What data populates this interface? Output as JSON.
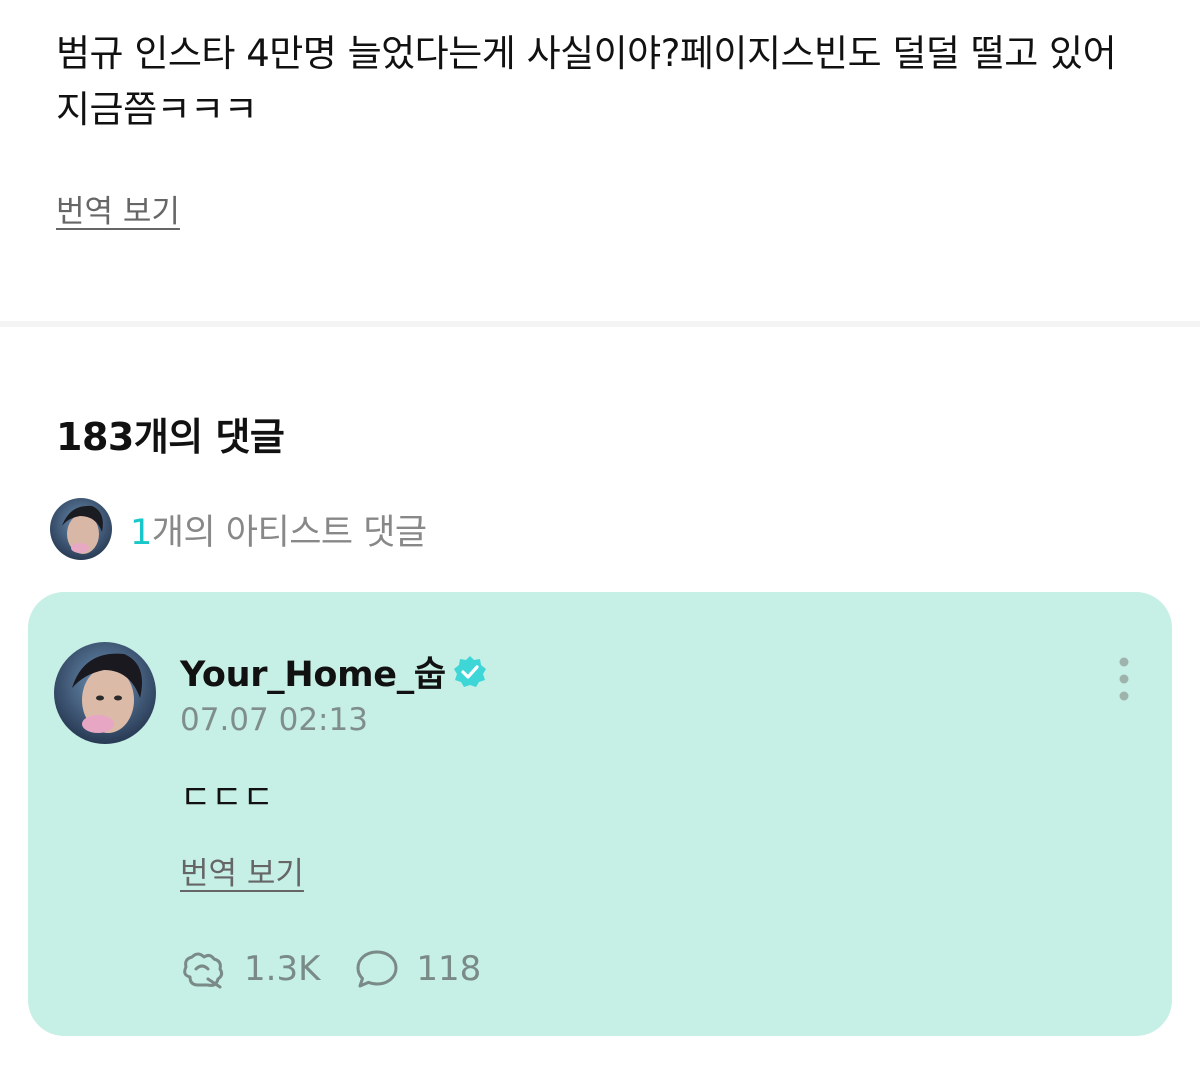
{
  "post": {
    "text": "범규 인스타 4만명 늘었다는게 사실이야?페이지스빈도 덜덜 떨고 있어 지금쯤ㅋㅋㅋ",
    "translate_label": "번역 보기"
  },
  "comments": {
    "count_label": "183개의 댓글",
    "artist_summary": {
      "count": "1",
      "label_suffix": "개의 아티스트 댓글"
    }
  },
  "artist_comment": {
    "username": "Your_Home_숩",
    "timestamp": "07.07 02:13",
    "body": "ㄷㄷㄷ",
    "translate_label": "번역 보기",
    "like_count": "1.3K",
    "reply_count": "118",
    "icons": {
      "verified": "verified-badge-icon",
      "more": "more-vertical-icon",
      "like": "like-icon",
      "reply": "comment-bubble-icon"
    },
    "colors": {
      "card_background": "#c6efe5",
      "verified": "#3fd6d8",
      "accent": "#19c6c9"
    }
  }
}
